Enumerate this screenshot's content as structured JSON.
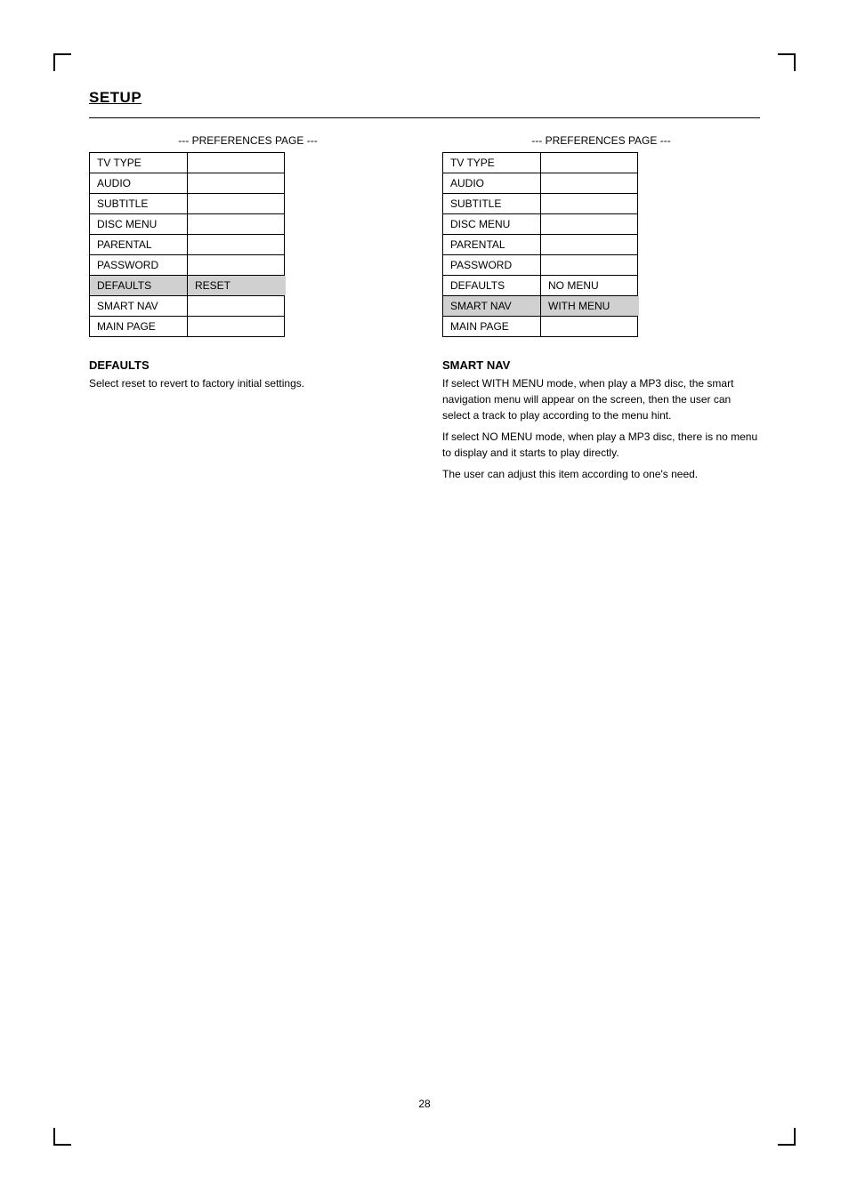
{
  "page": {
    "number": "28"
  },
  "setup": {
    "title": "SETUP"
  },
  "panel_left": {
    "header": "--- PREFERENCES PAGE ---",
    "items": [
      {
        "label": "TV TYPE",
        "option": "",
        "highlighted": false
      },
      {
        "label": "AUDIO",
        "option": "",
        "highlighted": false
      },
      {
        "label": "SUBTITLE",
        "option": "",
        "highlighted": false
      },
      {
        "label": "DISC MENU",
        "option": "",
        "highlighted": false
      },
      {
        "label": "PARENTAL",
        "option": "",
        "highlighted": false
      },
      {
        "label": "PASSWORD",
        "option": "",
        "highlighted": false
      },
      {
        "label": "DEFAULTS",
        "option": "RESET",
        "highlighted": true
      },
      {
        "label": "SMART NAV",
        "option": "",
        "highlighted": false
      },
      {
        "label": "MAIN PAGE",
        "option": "",
        "highlighted": false
      }
    ]
  },
  "panel_right": {
    "header": "--- PREFERENCES PAGE ---",
    "items": [
      {
        "label": "TV TYPE",
        "option": "",
        "highlighted": false
      },
      {
        "label": "AUDIO",
        "option": "",
        "highlighted": false
      },
      {
        "label": "SUBTITLE",
        "option": "",
        "highlighted": false
      },
      {
        "label": "DISC MENU",
        "option": "",
        "highlighted": false
      },
      {
        "label": "PARENTAL",
        "option": "",
        "highlighted": false
      },
      {
        "label": "PASSWORD",
        "option": "",
        "highlighted": false
      },
      {
        "label": "DEFAULTS",
        "option": "NO MENU",
        "highlighted": false
      },
      {
        "label": "SMART NAV",
        "option": "WITH MENU",
        "highlighted": true
      },
      {
        "label": "MAIN PAGE",
        "option": "",
        "highlighted": false
      }
    ]
  },
  "desc_left": {
    "title": "DEFAULTS",
    "text": "Select reset to revert to factory initial settings."
  },
  "desc_right": {
    "title": "SMART NAV",
    "lines": [
      "If select WITH MENU mode, when play a MP3 disc, the smart navigation menu will appear on the screen, then the user can select a track to play according to the menu hint.",
      "If select NO MENU mode, when play a MP3 disc, there is no menu to display and it starts to play directly.",
      "The user can adjust this item according to one's need."
    ]
  }
}
